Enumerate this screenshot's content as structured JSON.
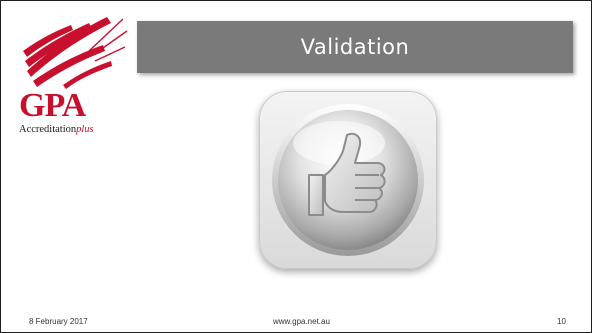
{
  "slide": {
    "title": "Validation",
    "logo": {
      "wordmark": "GPA",
      "subtitle_main": "Accreditation",
      "subtitle_accent": "plus",
      "brand_color": "#c8102e"
    },
    "icon": "thumbs-up-icon",
    "footer": {
      "date": "8 February 2017",
      "url": "www.gpa.net.au",
      "page_number": "10"
    },
    "colors": {
      "title_bar": "#7a7a7a",
      "title_text": "#ffffff"
    }
  }
}
